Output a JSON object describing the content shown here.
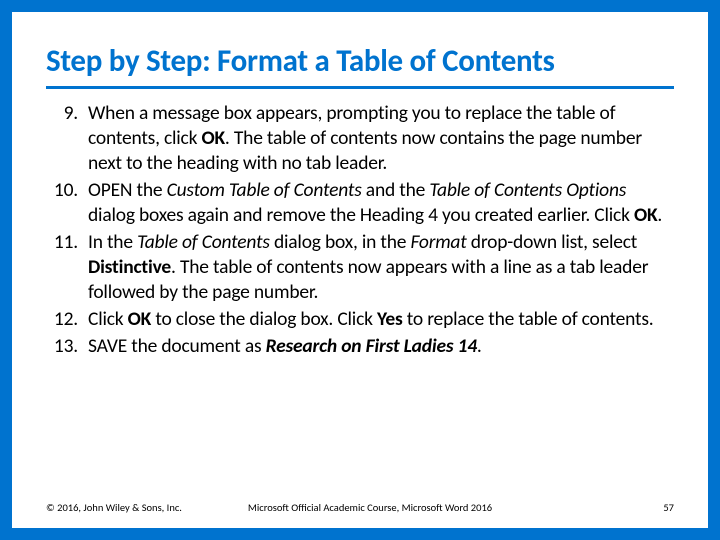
{
  "title": "Step by Step: Format a Table of Contents",
  "steps": [
    {
      "num": "9.",
      "html": "When a message box appears, prompting you to replace the table of contents, click <b>OK</b>. The table of contents now contains the page number next to the heading with no tab leader."
    },
    {
      "num": "10.",
      "html": "OPEN the <i>Custom Table of Contents</i> and the <i>Table of Contents Options</i> dialog boxes again and remove the Heading 4 you created earlier. Click <b>OK</b>."
    },
    {
      "num": "11.",
      "html": "In the <i>Table of Contents</i> dialog box, in the <i>Format</i> drop-down list, select <b>Distinctive</b>. The table of contents now appears with a line as a tab leader followed by the page number."
    },
    {
      "num": "12.",
      "html": "Click <b>OK</b> to close the dialog box. Click <b>Yes</b> to replace the table of contents."
    },
    {
      "num": "13.",
      "html": "SAVE the document as <b><i>Research on First Ladies 14</i></b>."
    }
  ],
  "footer": {
    "copyright": "© 2016, John Wiley & Sons, Inc.",
    "course": "Microsoft Official Academic Course, Microsoft Word 2016",
    "page": "57"
  }
}
